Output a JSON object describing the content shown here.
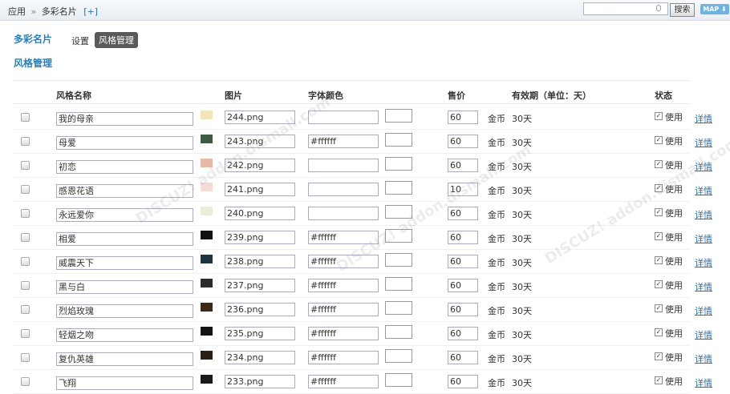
{
  "topbar": {
    "crumb_app": "应用",
    "crumb_sep": "»",
    "crumb_current": "多彩名片",
    "crumb_add": "[+]",
    "search_value": "",
    "search_button": "搜索",
    "map_button": "MAP ⬇"
  },
  "header": {
    "title": "多彩名片",
    "tab_settings": "设置",
    "tab_style_manage": "风格管理",
    "subtitle": "风格管理"
  },
  "table": {
    "columns": {
      "name": "风格名称",
      "image": "图片",
      "font_color": "字体颜色",
      "price": "售价",
      "validity": "有效期（单位：天）",
      "status": "状态"
    },
    "rows": [
      {
        "name": "我的母亲",
        "image": "244.png",
        "color": "",
        "price": "60",
        "unit": "金币",
        "days": "30天",
        "use": "使用",
        "detail": "详情",
        "thumb_color": "#f2e6b8"
      },
      {
        "name": "母爱",
        "image": "243.png",
        "color": "#ffffff",
        "price": "60",
        "unit": "金币",
        "days": "30天",
        "use": "使用",
        "detail": "详情",
        "thumb_color": "#3e5a40"
      },
      {
        "name": "初恋",
        "image": "242.png",
        "color": "",
        "price": "60",
        "unit": "金币",
        "days": "30天",
        "use": "使用",
        "detail": "详情",
        "thumb_color": "#e7b9a8"
      },
      {
        "name": "感恩花语",
        "image": "241.png",
        "color": "",
        "price": "10",
        "unit": "金币",
        "days": "30天",
        "use": "使用",
        "detail": "详情",
        "thumb_color": "#f3dcd8"
      },
      {
        "name": "永远爱你",
        "image": "240.png",
        "color": "",
        "price": "60",
        "unit": "金币",
        "days": "30天",
        "use": "使用",
        "detail": "详情",
        "thumb_color": "#e9efd9"
      },
      {
        "name": "相爱",
        "image": "239.png",
        "color": "#ffffff",
        "price": "60",
        "unit": "金币",
        "days": "30天",
        "use": "使用",
        "detail": "详情",
        "thumb_color": "#111111"
      },
      {
        "name": "威震天下",
        "image": "238.png",
        "color": "#ffffff",
        "price": "60",
        "unit": "金币",
        "days": "30天",
        "use": "使用",
        "detail": "详情",
        "thumb_color": "#1f3340"
      },
      {
        "name": "黑与白",
        "image": "237.png",
        "color": "#ffffff",
        "price": "60",
        "unit": "金币",
        "days": "30天",
        "use": "使用",
        "detail": "详情",
        "thumb_color": "#2b2b2b"
      },
      {
        "name": "烈焰玫瑰",
        "image": "236.png",
        "color": "#ffffff",
        "price": "60",
        "unit": "金币",
        "days": "30天",
        "use": "使用",
        "detail": "详情",
        "thumb_color": "#3a2a1a"
      },
      {
        "name": "轻烟之吻",
        "image": "235.png",
        "color": "#ffffff",
        "price": "60",
        "unit": "金币",
        "days": "30天",
        "use": "使用",
        "detail": "详情",
        "thumb_color": "#141414"
      },
      {
        "name": "复仇英雄",
        "image": "234.png",
        "color": "#ffffff",
        "price": "60",
        "unit": "金币",
        "days": "30天",
        "use": "使用",
        "detail": "详情",
        "thumb_color": "#2a1e16"
      },
      {
        "name": "飞翔",
        "image": "233.png",
        "color": "#ffffff",
        "price": "60",
        "unit": "金币",
        "days": "30天",
        "use": "使用",
        "detail": "详情",
        "thumb_color": "#1a1a1a"
      }
    ]
  }
}
